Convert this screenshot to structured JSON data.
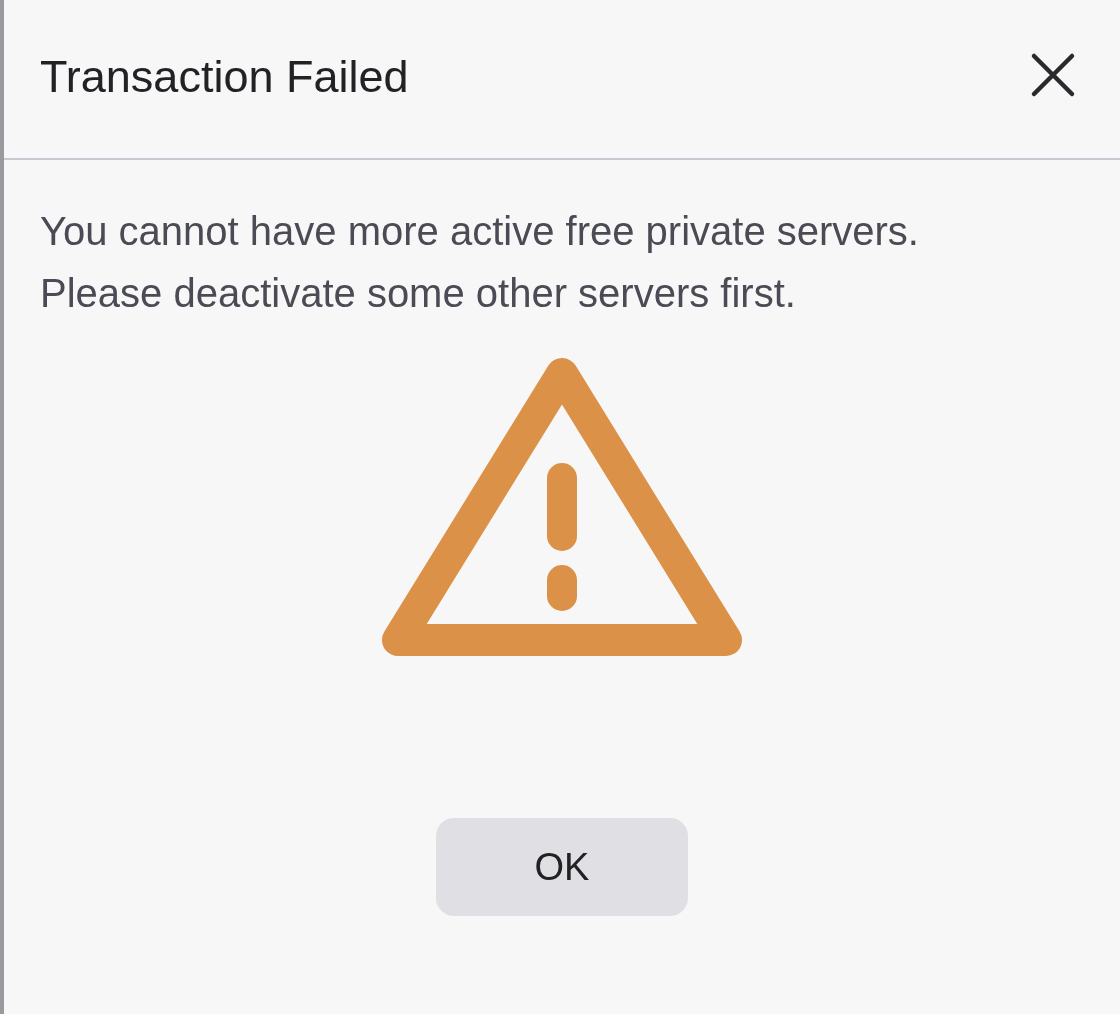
{
  "dialog": {
    "title": "Transaction Failed",
    "message": "You cannot have more active free private servers. Please deactivate some other servers first.",
    "buttons": [
      "OK"
    ]
  }
}
